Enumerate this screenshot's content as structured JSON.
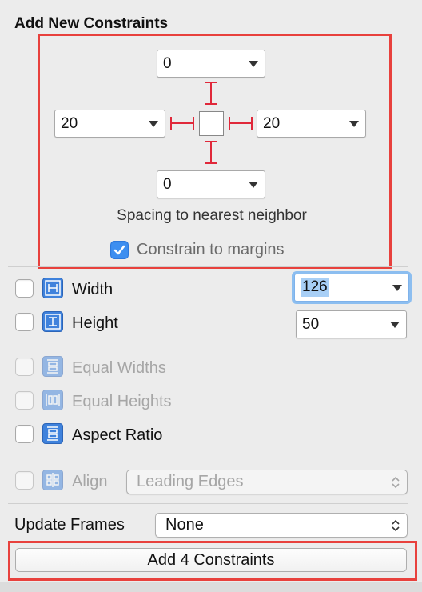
{
  "title": "Add New Constraints",
  "spacing": {
    "top": "0",
    "left": "20",
    "right": "20",
    "bottom": "0",
    "caption": "Spacing to nearest neighbor",
    "margins_label": "Constrain to margins",
    "margins_checked": true
  },
  "size": {
    "width_label": "Width",
    "width_value": "126",
    "height_label": "Height",
    "height_value": "50"
  },
  "equal": {
    "widths_label": "Equal Widths",
    "heights_label": "Equal Heights",
    "aspect_label": "Aspect Ratio"
  },
  "align": {
    "label": "Align",
    "value": "Leading Edges"
  },
  "update_frames": {
    "label": "Update Frames",
    "value": "None"
  },
  "add_button": "Add 4 Constraints",
  "colors": {
    "highlight_frame": "#e8413d",
    "strut": "#e0283a",
    "accent": "#3d8ef0"
  }
}
